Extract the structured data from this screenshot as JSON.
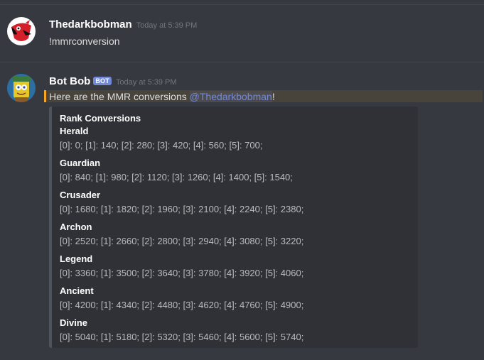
{
  "messages": [
    {
      "username": "Thedarkbobman",
      "timestamp": "Today at 5:39 PM",
      "text": "!mmrconversion"
    },
    {
      "username": "Bot Bob",
      "bot_tag": "BOT",
      "timestamp": "Today at 5:39 PM",
      "text_prefix": "Here are the MMR conversions ",
      "mention": "@Thedarkbobman",
      "text_suffix": "!",
      "embed": {
        "title": "Rank Conversions",
        "fields": [
          {
            "name": "Herald",
            "value": "[0]: 0; [1]: 140; [2]: 280; [3]: 420; [4]: 560; [5]: 700;"
          },
          {
            "name": "Guardian",
            "value": "[0]: 840; [1]: 980; [2]: 1120; [3]: 1260; [4]: 1400; [5]: 1540;"
          },
          {
            "name": "Crusader",
            "value": "[0]: 1680; [1]: 1820; [2]: 1960; [3]: 2100; [4]: 2240; [5]: 2380;"
          },
          {
            "name": "Archon",
            "value": "[0]: 2520; [1]: 2660; [2]: 2800; [3]: 2940; [4]: 3080; [5]: 3220;"
          },
          {
            "name": "Legend",
            "value": "[0]: 3360; [1]: 3500; [2]: 3640; [3]: 3780; [4]: 3920; [5]: 4060;"
          },
          {
            "name": "Ancient",
            "value": "[0]: 4200; [1]: 4340; [2]: 4480; [3]: 4620; [4]: 4760; [5]: 4900;"
          },
          {
            "name": "Divine",
            "value": "[0]: 5040; [1]: 5180; [2]: 5320; [3]: 5460; [4]: 5600; [5]: 5740;"
          }
        ]
      }
    }
  ],
  "colors": {
    "background": "#36393f",
    "embed_background": "#2f3136",
    "mention": "#7289da",
    "highlight_bar": "#faa61a",
    "bot_tag": "#7289da"
  },
  "icons": {
    "user_avatar": "red-bird-avatar-icon",
    "bot_avatar": "sponge-character-avatar-icon"
  }
}
